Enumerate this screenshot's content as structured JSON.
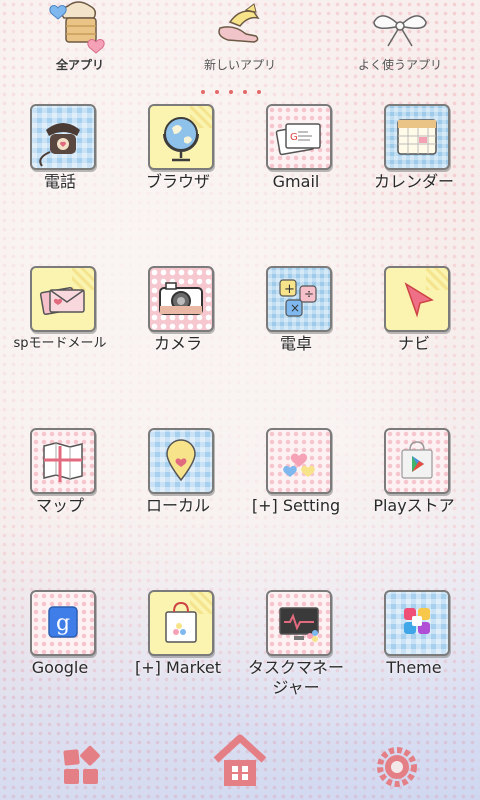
{
  "tabs": {
    "all_apps": "全アプリ",
    "new_apps": "新しいアプリ",
    "frequent_apps": "よく使うアプリ"
  },
  "apps": [
    {
      "label": "電話",
      "icon": "phone-icon"
    },
    {
      "label": "ブラウザ",
      "icon": "globe-icon"
    },
    {
      "label": "Gmail",
      "icon": "mail-icon"
    },
    {
      "label": "カレンダー",
      "icon": "calendar-icon"
    },
    {
      "label": "spモードメール",
      "icon": "envelope-heart-icon"
    },
    {
      "label": "カメラ",
      "icon": "camera-icon"
    },
    {
      "label": "電卓",
      "icon": "calculator-icon"
    },
    {
      "label": "ナビ",
      "icon": "arrow-pointer-icon"
    },
    {
      "label": "マップ",
      "icon": "map-icon"
    },
    {
      "label": "ローカル",
      "icon": "location-pin-icon"
    },
    {
      "label": "[+] Setting",
      "icon": "hearts-balloon-icon"
    },
    {
      "label": "Playストア",
      "icon": "play-bag-icon"
    },
    {
      "label": "Google",
      "icon": "google-icon"
    },
    {
      "label": "[+] Market",
      "icon": "shopping-bag-icon"
    },
    {
      "label": "タスクマネージャー",
      "icon": "monitor-icon"
    },
    {
      "label": "Theme",
      "icon": "theme-flower-icon"
    }
  ],
  "dock": {
    "left": "grid-squares-icon",
    "center": "home-icon",
    "right": "gear-icon"
  }
}
